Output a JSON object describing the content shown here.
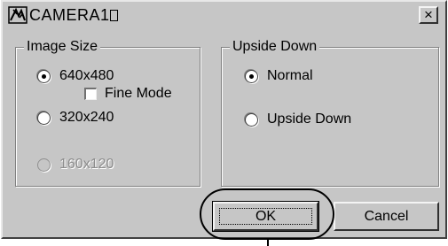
{
  "window": {
    "title": "CAMERA1",
    "app_icon": "camera-app-icon",
    "close_glyph": "×"
  },
  "image_size": {
    "title": "Image Size",
    "options": [
      {
        "label": "640x480",
        "checked": true,
        "disabled": false
      },
      {
        "label": "320x240",
        "checked": false,
        "disabled": false
      },
      {
        "label": "160x120",
        "checked": false,
        "disabled": true
      }
    ],
    "fine_mode": {
      "label": "Fine Mode",
      "checked": false
    }
  },
  "upside_down": {
    "title": "Upside Down",
    "options": [
      {
        "label": "Normal",
        "checked": true
      },
      {
        "label": "Upside Down",
        "checked": false
      }
    ]
  },
  "buttons": {
    "ok_label": "OK",
    "cancel_label": "Cancel"
  }
}
